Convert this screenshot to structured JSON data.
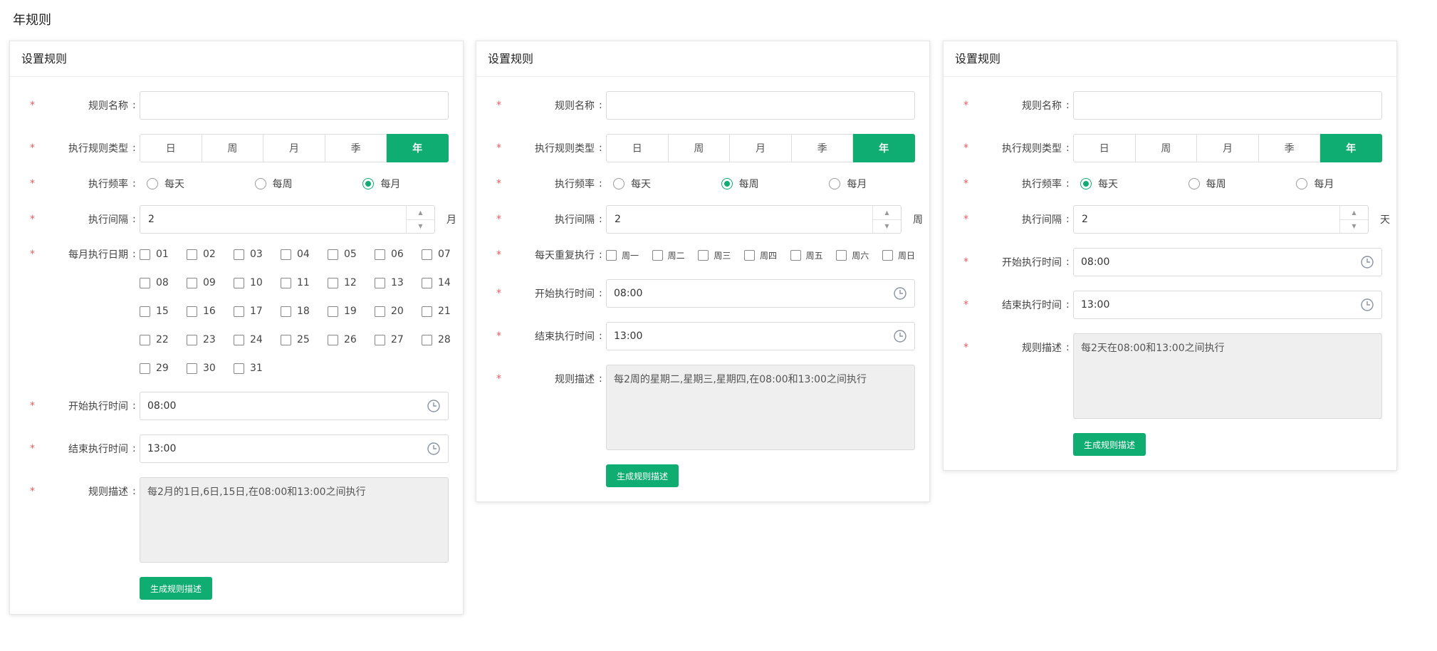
{
  "page_title": "年规则",
  "icons": {
    "clock": "clock-icon",
    "up": "caret-up-icon",
    "down": "caret-down-icon"
  },
  "accent_color": "#0fad72",
  "cards": [
    {
      "header": "设置规则",
      "labels": {
        "name": "规则名称",
        "type": "执行规则类型",
        "freq": "执行频率",
        "interval": "执行间隔",
        "days": "每月执行日期",
        "start": "开始执行时间",
        "end": "结束执行时间",
        "desc": "规则描述"
      },
      "name_value": "",
      "type_options": [
        "日",
        "周",
        "月",
        "季",
        "年"
      ],
      "type_selected": "年",
      "freq_options": [
        "每天",
        "每周",
        "每月"
      ],
      "freq_selected": "每月",
      "interval_value": "2",
      "interval_unit": "月",
      "days": [
        "01",
        "02",
        "03",
        "04",
        "05",
        "06",
        "07",
        "08",
        "09",
        "10",
        "11",
        "12",
        "13",
        "14",
        "15",
        "16",
        "17",
        "18",
        "19",
        "20",
        "21",
        "22",
        "23",
        "24",
        "25",
        "26",
        "27",
        "28",
        "29",
        "30",
        "31"
      ],
      "start_time": "08:00",
      "end_time": "13:00",
      "description": "每2月的1日,6日,15日,在08:00和13:00之间执行",
      "generate_label": "生成规则描述"
    },
    {
      "header": "设置规则",
      "labels": {
        "name": "规则名称",
        "type": "执行规则类型",
        "freq": "执行频率",
        "interval": "执行间隔",
        "weekdays": "每天重复执行",
        "start": "开始执行时间",
        "end": "结束执行时间",
        "desc": "规则描述"
      },
      "name_value": "",
      "type_options": [
        "日",
        "周",
        "月",
        "季",
        "年"
      ],
      "type_selected": "年",
      "freq_options": [
        "每天",
        "每周",
        "每月"
      ],
      "freq_selected": "每周",
      "interval_value": "2",
      "interval_unit": "周",
      "weekdays": [
        "周一",
        "周二",
        "周三",
        "周四",
        "周五",
        "周六",
        "周日"
      ],
      "start_time": "08:00",
      "end_time": "13:00",
      "description": "每2周的星期二,星期三,星期四,在08:00和13:00之间执行",
      "generate_label": "生成规则描述"
    },
    {
      "header": "设置规则",
      "labels": {
        "name": "规则名称",
        "type": "执行规则类型",
        "freq": "执行频率",
        "interval": "执行间隔",
        "start": "开始执行时间",
        "end": "结束执行时间",
        "desc": "规则描述"
      },
      "name_value": "",
      "type_options": [
        "日",
        "周",
        "月",
        "季",
        "年"
      ],
      "type_selected": "年",
      "freq_options": [
        "每天",
        "每周",
        "每月"
      ],
      "freq_selected": "每天",
      "interval_value": "2",
      "interval_unit": "天",
      "start_time": "08:00",
      "end_time": "13:00",
      "description": "每2天在08:00和13:00之间执行",
      "generate_label": "生成规则描述"
    }
  ]
}
